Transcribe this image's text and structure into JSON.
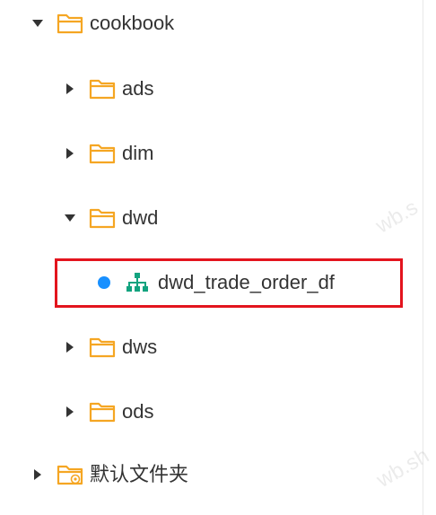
{
  "tree": {
    "root": {
      "label": "cookbook",
      "expanded": true,
      "children": [
        {
          "label": "ads",
          "expanded": false
        },
        {
          "label": "dim",
          "expanded": false
        },
        {
          "label": "dwd",
          "expanded": true,
          "children": [
            {
              "label": "dwd_trade_order_df",
              "status_color": "#1890ff",
              "icon": "lineage-node-icon",
              "highlighted": true
            }
          ]
        },
        {
          "label": "dws",
          "expanded": false
        },
        {
          "label": "ods",
          "expanded": false
        }
      ]
    },
    "default_folder": {
      "label": "默认文件夹",
      "expanded": false
    }
  },
  "watermark": {
    "text_top": "wb.s",
    "text_bottom": "wb.sh"
  },
  "colors": {
    "folder": "#f5a623",
    "highlight_border": "#e3141e",
    "node_icon": "#12a37f",
    "status_dot": "#1890ff"
  }
}
